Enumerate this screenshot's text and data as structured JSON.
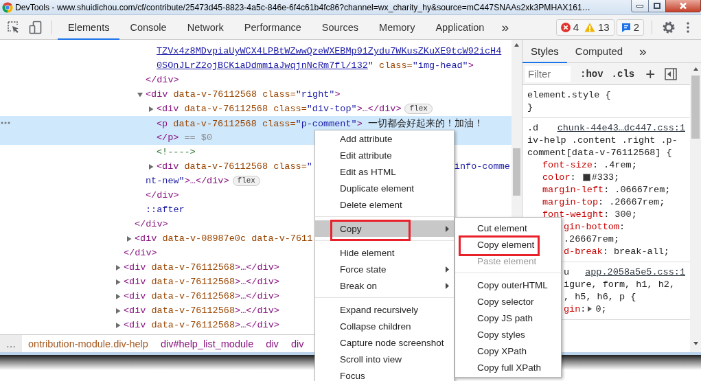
{
  "window": {
    "title": "DevTools - www.shuidichou.com/cf/contribute/25473d45-8823-4a5c-846e-6f4c61b4fc86?channel=wx_charity_hy&source=mC447SNAAs2xk3PMHAX161…"
  },
  "toolbar": {
    "tabs": [
      {
        "label": "Elements",
        "selected": true
      },
      {
        "label": "Console",
        "selected": false
      },
      {
        "label": "Network",
        "selected": false
      },
      {
        "label": "Performance",
        "selected": false
      },
      {
        "label": "Sources",
        "selected": false
      },
      {
        "label": "Memory",
        "selected": false
      },
      {
        "label": "Application",
        "selected": false
      }
    ],
    "more": "»",
    "issues": [
      {
        "kind": "error",
        "count": "4"
      },
      {
        "kind": "warning",
        "count": "13"
      }
    ],
    "messages": {
      "count": "2"
    }
  },
  "elements": {
    "rows": [
      {
        "children": [
          {
            "children": [
              {
                "children": [
                  {
                    "selected": false,
                    "segments": [
                      {
                        "kind": "link",
                        "text": "TZVx4z8MDvpiaUyWCX4LPBtWZwwQzeWXEBMp91Zydu7WKusZKuXE9tcW92icH4"
                      }
                    ]
                  },
                  {
                    "selected": false,
                    "segments": [
                      {
                        "kind": "link",
                        "text": "0SOnJLrZ2ojBCKiaDdmmiaJwqjnNcRm7fl/132"
                      },
                      {
                        "kind": "value",
                        "text": "\""
                      },
                      {
                        "kind": "attr",
                        "text": " class="
                      },
                      {
                        "kind": "value",
                        "text": "\"img-head\""
                      },
                      {
                        "kind": "tag",
                        "text": ">"
                      }
                    ]
                  }
                ]
              },
              {
                "selected": false,
                "segments": [
                  {
                    "kind": "tag",
                    "text": "</div>"
                  }
                ]
              },
              {
                "selected": false,
                "expanded": true,
                "segments": [
                  {
                    "kind": "tag",
                    "text": "<div"
                  },
                  {
                    "kind": "attr",
                    "text": " data-v-76112568 class="
                  },
                  {
                    "kind": "value",
                    "text": "\"right\""
                  },
                  {
                    "kind": "tag",
                    "text": ">"
                  }
                ],
                "children": [
                  {
                    "selected": false,
                    "expanded": false,
                    "segments": [
                      {
                        "kind": "tag",
                        "text": "<div"
                      },
                      {
                        "kind": "attr",
                        "text": " data-v-76112568 class="
                      },
                      {
                        "kind": "value",
                        "text": "\"div-top\""
                      },
                      {
                        "kind": "tag",
                        "text": ">…</div>"
                      }
                    ],
                    "badge": "flex"
                  },
                  {
                    "selected": true,
                    "ellipsis": true,
                    "segments": [
                      {
                        "kind": "tag",
                        "text": "<p"
                      },
                      {
                        "kind": "attr",
                        "text": " data-v-76112568 class="
                      },
                      {
                        "kind": "value",
                        "text": "\"p-comment\""
                      },
                      {
                        "kind": "tag",
                        "text": ">"
                      },
                      {
                        "kind": "text",
                        "text": " 一切都会好起来的！加油！"
                      }
                    ]
                  },
                  {
                    "selected": true,
                    "segments": [
                      {
                        "kind": "tag",
                        "text": "</p>"
                      },
                      {
                        "kind": "dim",
                        "text": " == $0"
                      }
                    ]
                  },
                  {
                    "selected": false,
                    "segments": [
                      {
                        "kind": "comment",
                        "text": "<!---->"
                      }
                    ]
                  },
                  {
                    "selected": false,
                    "expanded": false,
                    "segments": [
                      {
                        "kind": "tag",
                        "text": "<div"
                      },
                      {
                        "kind": "attr",
                        "text": " data-v-76112568 class="
                      },
                      {
                        "kind": "value",
                        "text": "\""
                      }
                    ],
                    "tail": [
                      {
                        "kind": "value",
                        "text": "info-comme"
                      }
                    ]
                  }
                ]
              },
              {
                "selected": false,
                "segments": [
                  {
                    "kind": "value",
                    "text": "nt-new\""
                  },
                  {
                    "kind": "tag",
                    "text": ">…</div>"
                  }
                ],
                "badge": "flex"
              },
              {
                "selected": false,
                "segments": [
                  {
                    "kind": "tag",
                    "text": "</div>"
                  }
                ]
              },
              {
                "selected": false,
                "segments": [
                  {
                    "kind": "pseudo",
                    "text": "::after"
                  }
                ]
              }
            ]
          },
          {
            "selected": false,
            "segments": [
              {
                "kind": "tag",
                "text": "</div>"
              }
            ]
          },
          {
            "selected": false,
            "expanded": false,
            "segments": [
              {
                "kind": "tag",
                "text": "<div"
              },
              {
                "kind": "attr",
                "text": " data-v-08987e0c data-v-7611"
              }
            ]
          }
        ]
      },
      {
        "selected": false,
        "segments": [
          {
            "kind": "tag",
            "text": "</div>"
          }
        ]
      },
      {
        "selected": false,
        "expanded": false,
        "segments": [
          {
            "kind": "tag",
            "text": "<div"
          },
          {
            "kind": "attr",
            "text": " data-v-76112568"
          },
          {
            "kind": "tag",
            "text": ">…</div>"
          }
        ]
      },
      {
        "selected": false,
        "expanded": false,
        "segments": [
          {
            "kind": "tag",
            "text": "<div"
          },
          {
            "kind": "attr",
            "text": " data-v-76112568"
          },
          {
            "kind": "tag",
            "text": ">…</div>"
          }
        ]
      },
      {
        "selected": false,
        "expanded": false,
        "segments": [
          {
            "kind": "tag",
            "text": "<div"
          },
          {
            "kind": "attr",
            "text": " data-v-76112568"
          },
          {
            "kind": "tag",
            "text": ">…</div>"
          }
        ]
      },
      {
        "selected": false,
        "expanded": false,
        "segments": [
          {
            "kind": "tag",
            "text": "<div"
          },
          {
            "kind": "attr",
            "text": " data-v-76112568"
          },
          {
            "kind": "tag",
            "text": ">…</div>"
          }
        ]
      },
      {
        "selected": false,
        "expanded": false,
        "segments": [
          {
            "kind": "tag",
            "text": "<div"
          },
          {
            "kind": "attr",
            "text": " data-v-76112568"
          },
          {
            "kind": "tag",
            "text": ">…</div>"
          }
        ]
      }
    ]
  },
  "breadcrumbs": {
    "overflow": "…",
    "items": [
      {
        "kind": "class",
        "text": "ontribution-module.div-help"
      },
      {
        "kind": "tag",
        "text": "div#help_list_module"
      },
      {
        "kind": "tag",
        "text": "div"
      },
      {
        "kind": "tag",
        "text": "div"
      }
    ]
  },
  "styles_pane": {
    "tabs": [
      {
        "label": "Styles",
        "selected": true
      },
      {
        "label": "Computed",
        "selected": false
      }
    ],
    "more": "»",
    "filter": {
      "placeholder": "Filter"
    },
    "hov": ":hov",
    "cls": ".cls",
    "add": "+",
    "rules": [
      {
        "lines": [
          {
            "kind": "selector",
            "covered": false,
            "segments": [
              {
                "kind": "sel",
                "text": "element.style {"
              }
            ]
          },
          {
            "kind": "selector",
            "covered": false,
            "segments": [
              {
                "kind": "sel",
                "text": "}"
              }
            ]
          }
        ]
      },
      {
        "source": "chunk-44e43…dc447.css:1",
        "lines": [
          {
            "kind": "selector",
            "covered": false,
            "segments": [
              {
                "kind": "sel",
                "text": ".d"
              }
            ]
          },
          {
            "kind": "selector",
            "covered": false,
            "segments": [
              {
                "kind": "sel",
                "text": "iv-help .content .right .p-"
              }
            ]
          },
          {
            "kind": "selector",
            "covered": false,
            "segments": [
              {
                "kind": "sel",
                "text": "comment[data-v-76112568] {"
              }
            ]
          },
          {
            "kind": "property",
            "covered": false,
            "segments": [
              {
                "kind": "prop",
                "text": "font-size"
              },
              {
                "kind": "val",
                "text": ": .4rem;"
              }
            ]
          },
          {
            "kind": "property",
            "covered": false,
            "segments": [
              {
                "kind": "prop",
                "text": "color"
              },
              {
                "kind": "val",
                "text": ": "
              },
              {
                "kind": "swatch",
                "color": "#333333"
              },
              {
                "kind": "val",
                "text": "#333;"
              }
            ]
          },
          {
            "kind": "property",
            "covered": false,
            "segments": [
              {
                "kind": "prop",
                "text": "margin-left"
              },
              {
                "kind": "val",
                "text": ": .06667rem;"
              }
            ]
          },
          {
            "kind": "property",
            "covered": false,
            "segments": [
              {
                "kind": "prop",
                "text": "margin-top"
              },
              {
                "kind": "val",
                "text": ": .26667rem;"
              }
            ]
          },
          {
            "kind": "property",
            "covered": false,
            "segments": [
              {
                "kind": "prop",
                "text": "font-weight"
              },
              {
                "kind": "val",
                "text": ": 300;"
              }
            ]
          },
          {
            "kind": "property",
            "covered": true,
            "segments": [
              {
                "kind": "prop",
                "text": "gin-bottom"
              },
              {
                "kind": "val",
                "text": ":"
              }
            ]
          },
          {
            "kind": "property",
            "covered": true,
            "segments": [
              {
                "kind": "val",
                "text": ".26667rem;"
              }
            ]
          },
          {
            "kind": "property",
            "covered": true,
            "segments": [
              {
                "kind": "prop",
                "text": "d-break"
              },
              {
                "kind": "val",
                "text": ": break-all;"
              }
            ]
          }
        ]
      },
      {
        "source": "app.2058a5e5.css:1",
        "lines": [
          {
            "kind": "selector",
            "covered": true,
            "segments": [
              {
                "kind": "sel",
                "text": "u"
              }
            ]
          },
          {
            "kind": "selector",
            "covered": true,
            "segments": [
              {
                "kind": "sel",
                "text": "igure, form, h1, h2,"
              }
            ]
          },
          {
            "kind": "selector",
            "covered": true,
            "segments": [
              {
                "kind": "sel",
                "text": ", h5, h6, p {"
              }
            ]
          },
          {
            "kind": "property",
            "covered": true,
            "segments": [
              {
                "kind": "prop",
                "text": "gin"
              },
              {
                "kind": "val",
                "text": ":"
              },
              {
                "kind": "expander"
              },
              {
                "kind": "val",
                "text": "0;"
              }
            ]
          }
        ]
      }
    ]
  },
  "context_menu": {
    "items": [
      {
        "kind": "item",
        "label": "Add attribute",
        "highlighted": false,
        "submenu": false,
        "annotated": false
      },
      {
        "kind": "item",
        "label": "Edit attribute",
        "highlighted": false,
        "submenu": false,
        "annotated": false
      },
      {
        "kind": "item",
        "label": "Edit as HTML",
        "highlighted": false,
        "submenu": false,
        "annotated": false
      },
      {
        "kind": "item",
        "label": "Duplicate element",
        "highlighted": false,
        "submenu": false,
        "annotated": false
      },
      {
        "kind": "item",
        "label": "Delete element",
        "highlighted": false,
        "submenu": false,
        "annotated": false
      },
      {
        "kind": "separator"
      },
      {
        "kind": "item",
        "label": "Copy",
        "highlighted": true,
        "submenu": true,
        "annotated": true
      },
      {
        "kind": "separator"
      },
      {
        "kind": "item",
        "label": "Hide element",
        "highlighted": false,
        "submenu": false,
        "annotated": false
      },
      {
        "kind": "item",
        "label": "Force state",
        "highlighted": false,
        "submenu": true,
        "annotated": false
      },
      {
        "kind": "item",
        "label": "Break on",
        "highlighted": false,
        "submenu": true,
        "annotated": false
      },
      {
        "kind": "separator"
      },
      {
        "kind": "item",
        "label": "Expand recursively",
        "highlighted": false,
        "submenu": false,
        "annotated": false
      },
      {
        "kind": "item",
        "label": "Collapse children",
        "highlighted": false,
        "submenu": false,
        "annotated": false
      },
      {
        "kind": "item",
        "label": "Capture node screenshot",
        "highlighted": false,
        "submenu": false,
        "annotated": false
      },
      {
        "kind": "item",
        "label": "Scroll into view",
        "highlighted": false,
        "submenu": false,
        "annotated": false
      },
      {
        "kind": "item",
        "label": "Focus",
        "highlighted": false,
        "submenu": false,
        "annotated": false
      }
    ]
  },
  "submenu": {
    "items": [
      {
        "kind": "item",
        "label": "Cut element",
        "disabled": false,
        "annotated": false
      },
      {
        "kind": "item",
        "label": "Copy element",
        "disabled": false,
        "annotated": true
      },
      {
        "kind": "item",
        "label": "Paste element",
        "disabled": true,
        "annotated": false
      },
      {
        "kind": "separator"
      },
      {
        "kind": "item",
        "label": "Copy outerHTML",
        "disabled": false,
        "annotated": false
      },
      {
        "kind": "item",
        "label": "Copy selector",
        "disabled": false,
        "annotated": false
      },
      {
        "kind": "item",
        "label": "Copy JS path",
        "disabled": false,
        "annotated": false
      },
      {
        "kind": "item",
        "label": "Copy styles",
        "disabled": false,
        "annotated": false
      },
      {
        "kind": "item",
        "label": "Copy XPath",
        "disabled": false,
        "annotated": false
      },
      {
        "kind": "item",
        "label": "Copy full XPath",
        "disabled": false,
        "annotated": false
      }
    ]
  }
}
